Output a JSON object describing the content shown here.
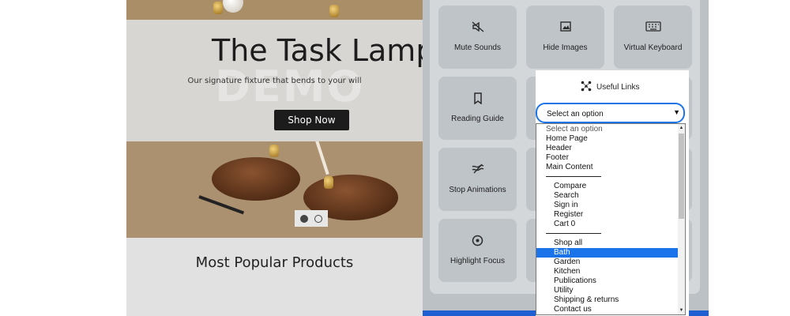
{
  "hero": {
    "title": "The Task Lamp",
    "subtitle": "Our signature fixture that bends to your will",
    "cta": "Shop Now",
    "watermark": "DEMO",
    "slides": 2,
    "active_slide": 1
  },
  "section": {
    "title": "Most Popular Products"
  },
  "accessibility": {
    "tiles": [
      {
        "label": "Mute Sounds",
        "icon": "mute-icon"
      },
      {
        "label": "Hide Images",
        "icon": "image-icon"
      },
      {
        "label": "Virtual Keyboard",
        "icon": "keyboard-icon"
      },
      {
        "label": "Reading Guide",
        "icon": "bookmark-icon"
      },
      {
        "label": "Stop Animations",
        "icon": "stop-animation-icon"
      },
      {
        "label": "Highlight Focus",
        "icon": "focus-icon"
      }
    ],
    "useful_links": {
      "title": "Useful Links",
      "icon": "network-icon",
      "selected": "Select an option",
      "options": [
        {
          "label": "Select an option",
          "level": 0,
          "placeholder": true
        },
        {
          "label": "Home Page",
          "level": 0
        },
        {
          "label": "Header",
          "level": 0
        },
        {
          "label": "Footer",
          "level": 0
        },
        {
          "label": "Main Content",
          "level": 0
        },
        {
          "separator": true
        },
        {
          "label": "Compare",
          "level": 1
        },
        {
          "label": "Search",
          "level": 1
        },
        {
          "label": "Sign in",
          "level": 1
        },
        {
          "label": "Register",
          "level": 1
        },
        {
          "label": "Cart 0",
          "level": 1
        },
        {
          "separator": true
        },
        {
          "label": "Shop all",
          "level": 1
        },
        {
          "label": "Bath",
          "level": 1,
          "highlighted": true
        },
        {
          "label": "Garden",
          "level": 1
        },
        {
          "label": "Kitchen",
          "level": 1
        },
        {
          "label": "Publications",
          "level": 1
        },
        {
          "label": "Utility",
          "level": 1
        },
        {
          "label": "Shipping & returns",
          "level": 1
        },
        {
          "label": "Contact us",
          "level": 1
        }
      ]
    }
  },
  "colors": {
    "accent": "#1a73e8",
    "panel": "#bcc1c6",
    "tile": "#bfc4c9",
    "hero_tan": "#ab9170",
    "button_dark": "#1c1c1c"
  }
}
